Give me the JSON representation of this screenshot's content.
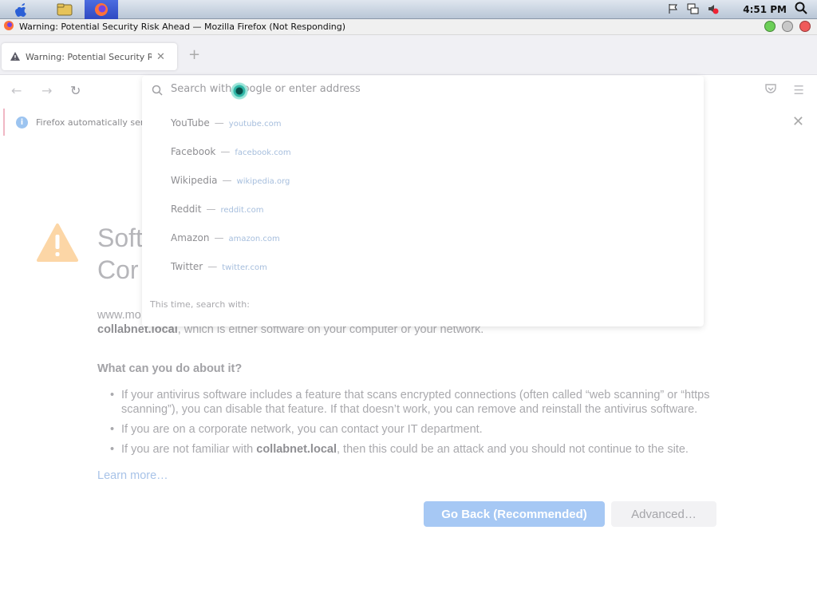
{
  "os": {
    "clock": "4:51 PM",
    "apps": [
      "apple-menu-icon",
      "file-manager-icon",
      "firefox-icon"
    ]
  },
  "window": {
    "title": "Warning: Potential Security Risk Ahead — Mozilla Firefox (Not Responding)"
  },
  "tabs": [
    {
      "label": "Warning: Potential Security Risk Ahead"
    }
  ],
  "url_bar": {
    "placeholder": "Search with Google or enter address"
  },
  "suggestions": [
    {
      "title": "YouTube",
      "url": "youtube.com"
    },
    {
      "title": "Facebook",
      "url": "facebook.com"
    },
    {
      "title": "Wikipedia",
      "url": "wikipedia.org"
    },
    {
      "title": "Reddit",
      "url": "reddit.com"
    },
    {
      "title": "Amazon",
      "url": "amazon.com"
    },
    {
      "title": "Twitter",
      "url": "twitter.com"
    }
  ],
  "one_off_label": "This time, search with:",
  "info_bar": {
    "text": "Firefox automatically sends"
  },
  "page": {
    "heading_line1": "Soft",
    "heading_line2": "Cor",
    "desc_line1": "www.mo",
    "desc_host": "collabnet.local",
    "desc_rest": ", which is either software on your computer or your network.",
    "what_heading": "What can you do about it?",
    "bullets": [
      "If your antivirus software includes a feature that scans encrypted connections (often called “web scanning” or “https scanning”), you can disable that feature. If that doesn’t work, you can remove and reinstall the antivirus software.",
      "If you are on a corporate network, you can contact your IT department."
    ],
    "bullet3_pre": "If you are not familiar with ",
    "bullet3_host": "collabnet.local",
    "bullet3_post": ", then this could be an attack and you should not continue to the site.",
    "learn_more": "Learn more…",
    "go_back": "Go Back (Recommended)",
    "advanced": "Advanced…"
  },
  "colors": {
    "accent": "#0060df",
    "warning": "#ffa436"
  }
}
